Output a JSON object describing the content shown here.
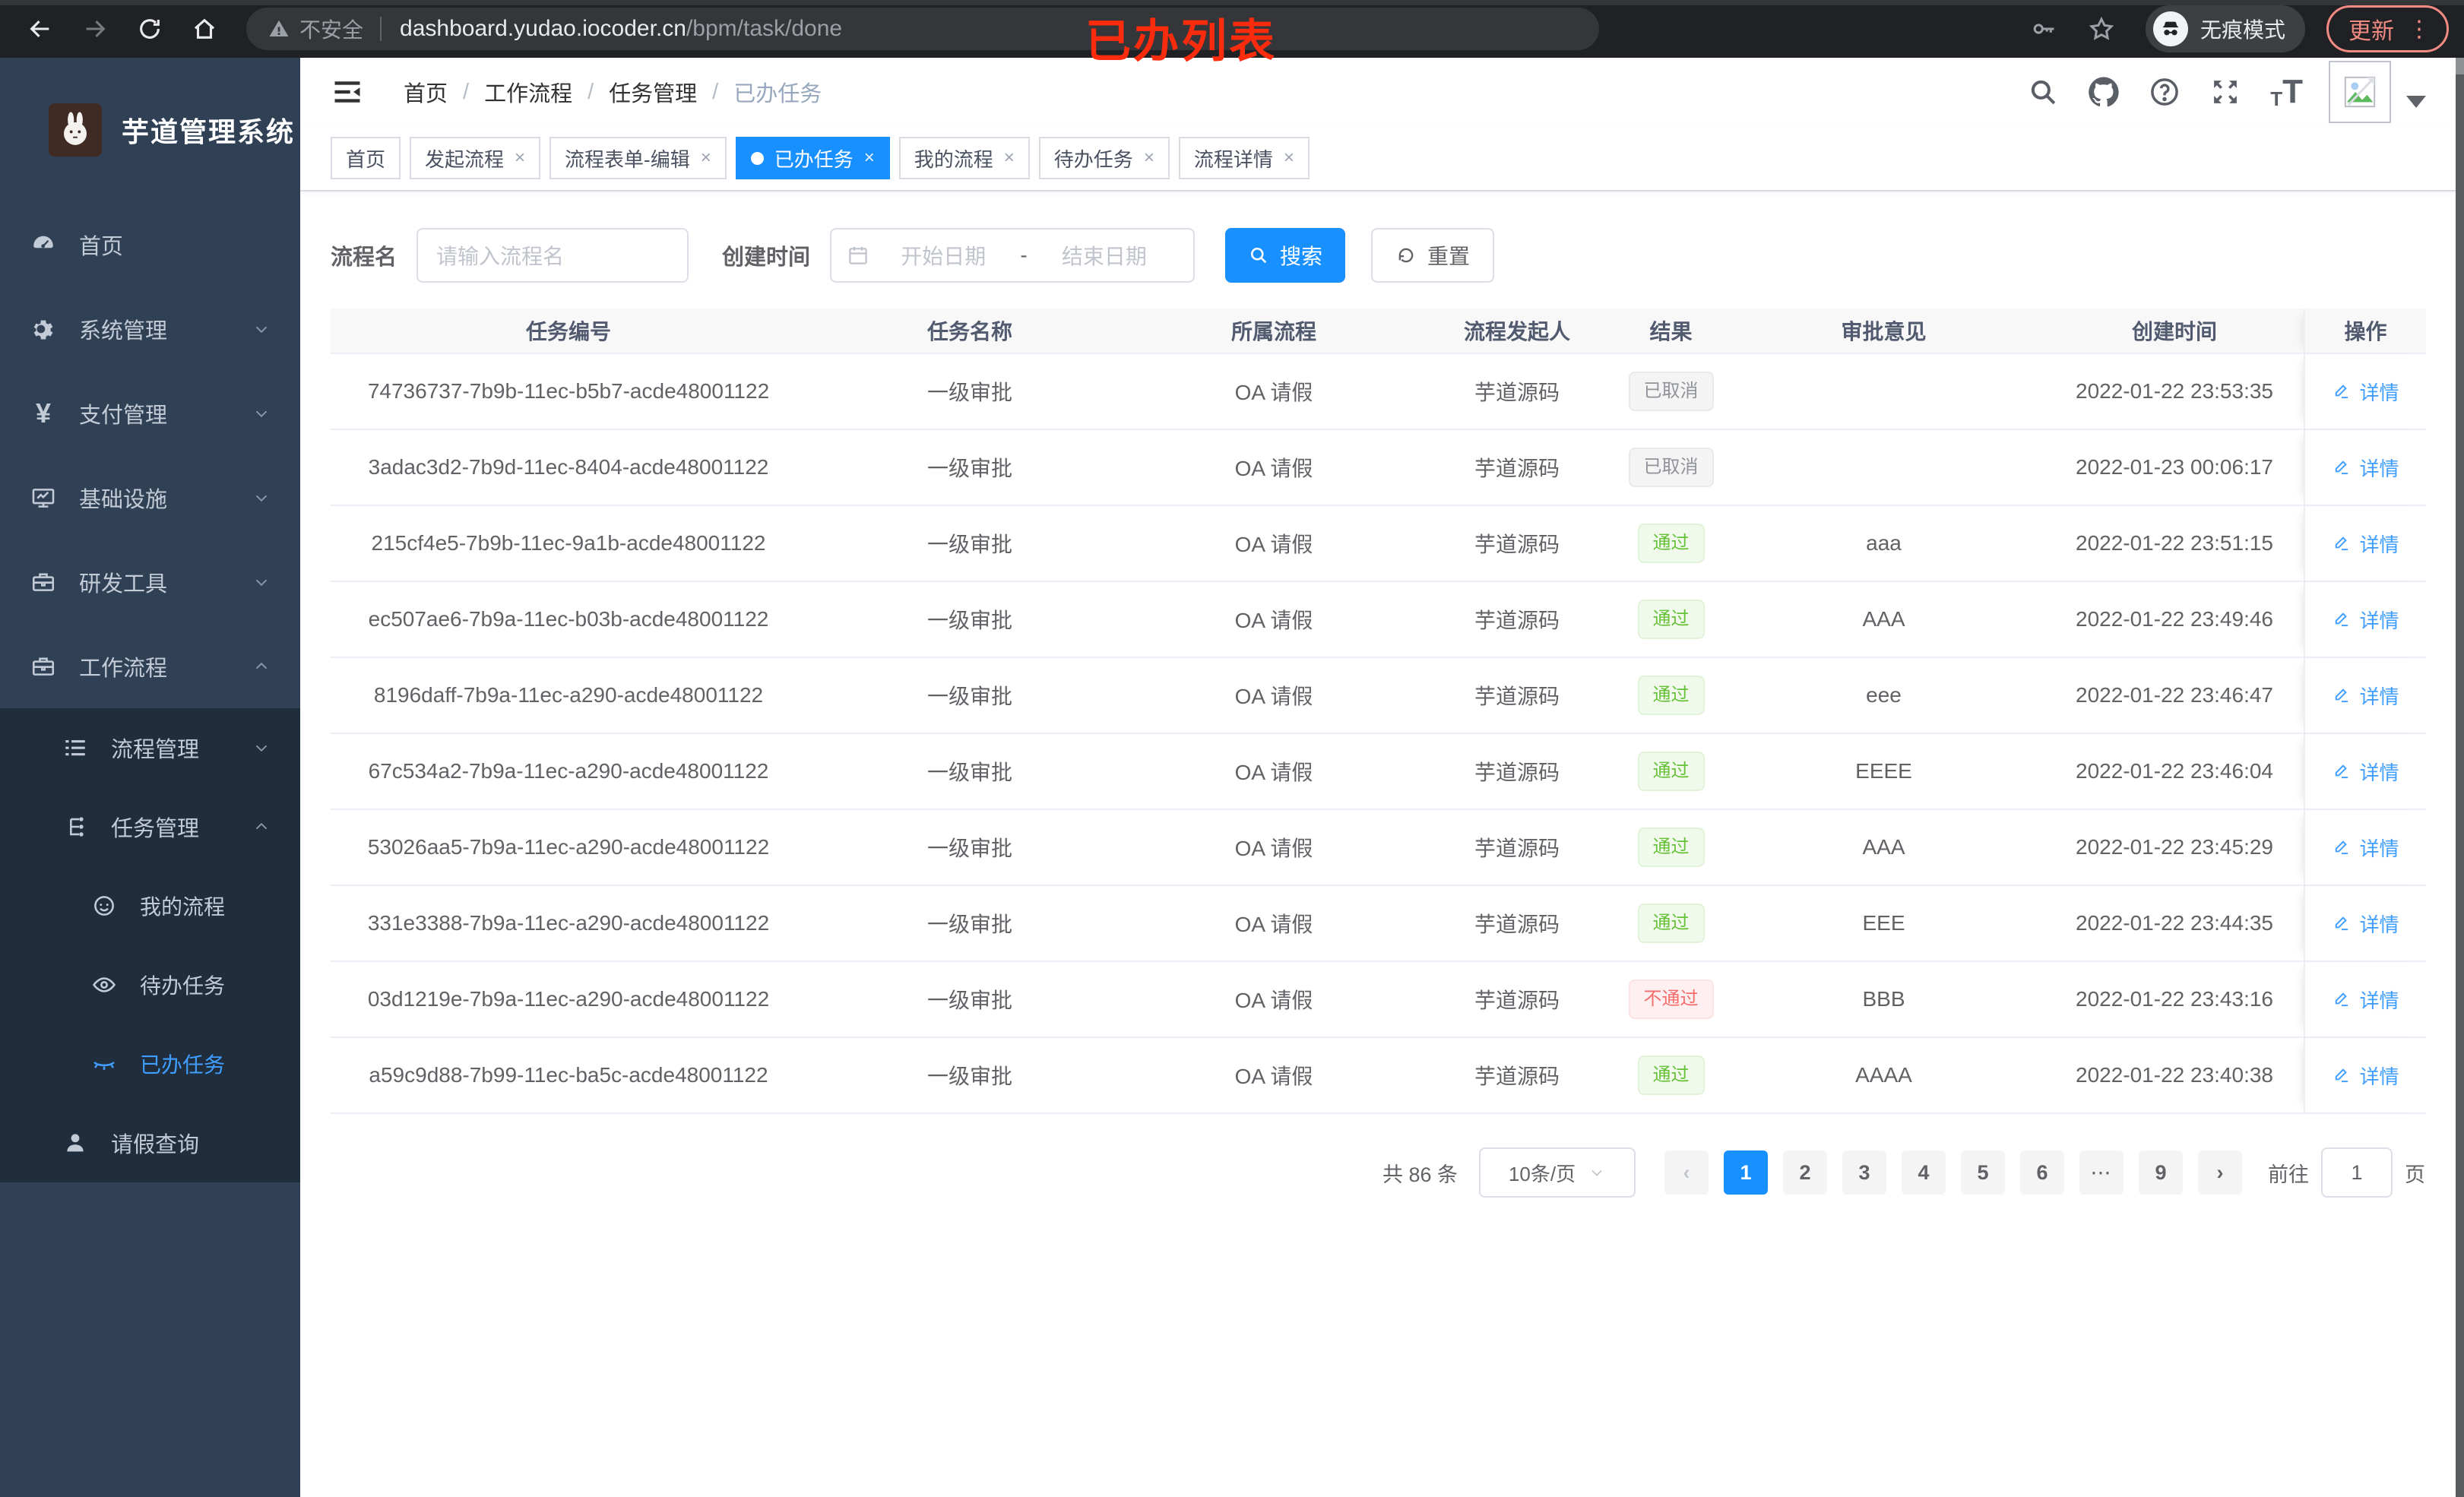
{
  "colors": {
    "accent": "#1890ff",
    "link": "#409eff",
    "success": "#67c23a",
    "danger": "#f56c6c",
    "info": "#909399",
    "sidebar_bg": "#304156",
    "submenu_bg": "#1f2d3d",
    "annotation": "#fa2c0d",
    "update": "#f28b82"
  },
  "browser": {
    "security_label": "不安全",
    "url_host": "dashboard.yudao.iocoder.cn",
    "url_path": "/bpm/task/done",
    "incognito_label": "无痕模式",
    "update_label": "更新",
    "update_dots": "⋮",
    "icons": [
      "back-icon",
      "forward-icon",
      "reload-icon",
      "home-icon",
      "warning-icon",
      "key-icon",
      "star-icon",
      "incognito-icon"
    ]
  },
  "annotation": "已办列表",
  "sidebar": {
    "logo_title": "芋道管理系统",
    "menu": [
      {
        "label": "首页",
        "icon": "dashboard-icon",
        "level": 1,
        "chevron": ""
      },
      {
        "label": "系统管理",
        "icon": "gear-icon",
        "level": 1,
        "chevron": "down"
      },
      {
        "label": "支付管理",
        "icon": "yen-icon",
        "level": 1,
        "chevron": "down"
      },
      {
        "label": "基础设施",
        "icon": "monitor-icon",
        "level": 1,
        "chevron": "down"
      },
      {
        "label": "研发工具",
        "icon": "toolbox-icon",
        "level": 1,
        "chevron": "down"
      },
      {
        "label": "工作流程",
        "icon": "briefcase-icon",
        "level": 1,
        "chevron": "up"
      },
      {
        "label": "流程管理",
        "icon": "list-icon",
        "level": 2,
        "chevron": "down",
        "sub": true
      },
      {
        "label": "任务管理",
        "icon": "flow-icon",
        "level": 2,
        "chevron": "up",
        "sub": true
      },
      {
        "label": "我的流程",
        "icon": "face-icon",
        "level": 3,
        "chevron": "",
        "sub": true
      },
      {
        "label": "待办任务",
        "icon": "eye-icon",
        "level": 3,
        "chevron": "",
        "sub": true
      },
      {
        "label": "已办任务",
        "icon": "eye-closed-icon",
        "level": 3,
        "chevron": "",
        "sub": true,
        "active": true
      },
      {
        "label": "请假查询",
        "icon": "user-icon",
        "level": 2,
        "chevron": "",
        "sub": true
      }
    ]
  },
  "header": {
    "breadcrumb": [
      "首页",
      "工作流程",
      "任务管理",
      "已办任务"
    ],
    "separator": "/",
    "right_icons": [
      "search-icon",
      "github-icon",
      "help-icon",
      "fullscreen-icon",
      "font-size-icon",
      "avatar",
      "caret-down-icon"
    ]
  },
  "tabs": {
    "close_glyph": "×",
    "items": [
      {
        "label": "首页",
        "closable": false,
        "active": false
      },
      {
        "label": "发起流程",
        "closable": true,
        "active": false
      },
      {
        "label": "流程表单-编辑",
        "closable": true,
        "active": false
      },
      {
        "label": "已办任务",
        "closable": true,
        "active": true
      },
      {
        "label": "我的流程",
        "closable": true,
        "active": false
      },
      {
        "label": "待办任务",
        "closable": true,
        "active": false
      },
      {
        "label": "流程详情",
        "closable": true,
        "active": false
      }
    ]
  },
  "filters": {
    "name_label": "流程名",
    "name_placeholder": "请输入流程名",
    "time_label": "创建时间",
    "start_placeholder": "开始日期",
    "range_separator": "-",
    "end_placeholder": "结束日期",
    "search_label": "搜索",
    "reset_label": "重置"
  },
  "table": {
    "columns": [
      "任务编号",
      "任务名称",
      "所属流程",
      "流程发起人",
      "结果",
      "审批意见",
      "创建时间",
      "操作"
    ],
    "detail_label": "详情",
    "rows": [
      {
        "id": "74736737-7b9b-11ec-b5b7-acde48001122",
        "name": "一级审批",
        "flow": "OA 请假",
        "starter": "芋道源码",
        "result": "已取消",
        "result_type": "info",
        "opinion": "",
        "time": "2022-01-22 23:53:35"
      },
      {
        "id": "3adac3d2-7b9d-11ec-8404-acde48001122",
        "name": "一级审批",
        "flow": "OA 请假",
        "starter": "芋道源码",
        "result": "已取消",
        "result_type": "info",
        "opinion": "",
        "time": "2022-01-23 00:06:17"
      },
      {
        "id": "215cf4e5-7b9b-11ec-9a1b-acde48001122",
        "name": "一级审批",
        "flow": "OA 请假",
        "starter": "芋道源码",
        "result": "通过",
        "result_type": "success",
        "opinion": "aaa",
        "time": "2022-01-22 23:51:15"
      },
      {
        "id": "ec507ae6-7b9a-11ec-b03b-acde48001122",
        "name": "一级审批",
        "flow": "OA 请假",
        "starter": "芋道源码",
        "result": "通过",
        "result_type": "success",
        "opinion": "AAA",
        "time": "2022-01-22 23:49:46"
      },
      {
        "id": "8196daff-7b9a-11ec-a290-acde48001122",
        "name": "一级审批",
        "flow": "OA 请假",
        "starter": "芋道源码",
        "result": "通过",
        "result_type": "success",
        "opinion": "eee",
        "time": "2022-01-22 23:46:47"
      },
      {
        "id": "67c534a2-7b9a-11ec-a290-acde48001122",
        "name": "一级审批",
        "flow": "OA 请假",
        "starter": "芋道源码",
        "result": "通过",
        "result_type": "success",
        "opinion": "EEEE",
        "time": "2022-01-22 23:46:04"
      },
      {
        "id": "53026aa5-7b9a-11ec-a290-acde48001122",
        "name": "一级审批",
        "flow": "OA 请假",
        "starter": "芋道源码",
        "result": "通过",
        "result_type": "success",
        "opinion": "AAA",
        "time": "2022-01-22 23:45:29"
      },
      {
        "id": "331e3388-7b9a-11ec-a290-acde48001122",
        "name": "一级审批",
        "flow": "OA 请假",
        "starter": "芋道源码",
        "result": "通过",
        "result_type": "success",
        "opinion": "EEE",
        "time": "2022-01-22 23:44:35"
      },
      {
        "id": "03d1219e-7b9a-11ec-a290-acde48001122",
        "name": "一级审批",
        "flow": "OA 请假",
        "starter": "芋道源码",
        "result": "不通过",
        "result_type": "danger",
        "opinion": "BBB",
        "time": "2022-01-22 23:43:16"
      },
      {
        "id": "a59c9d88-7b99-11ec-ba5c-acde48001122",
        "name": "一级审批",
        "flow": "OA 请假",
        "starter": "芋道源码",
        "result": "通过",
        "result_type": "success",
        "opinion": "AAAA",
        "time": "2022-01-22 23:40:38"
      }
    ]
  },
  "pagination": {
    "total_text": "共 86 条",
    "page_size": "10条/页",
    "prev_glyph": "‹",
    "next_glyph": "›",
    "pages": [
      "1",
      "2",
      "3",
      "4",
      "5",
      "6",
      "⋯",
      "9"
    ],
    "active_page": "1",
    "jump_label": "前往",
    "jump_value": "1",
    "jump_suffix": "页"
  }
}
